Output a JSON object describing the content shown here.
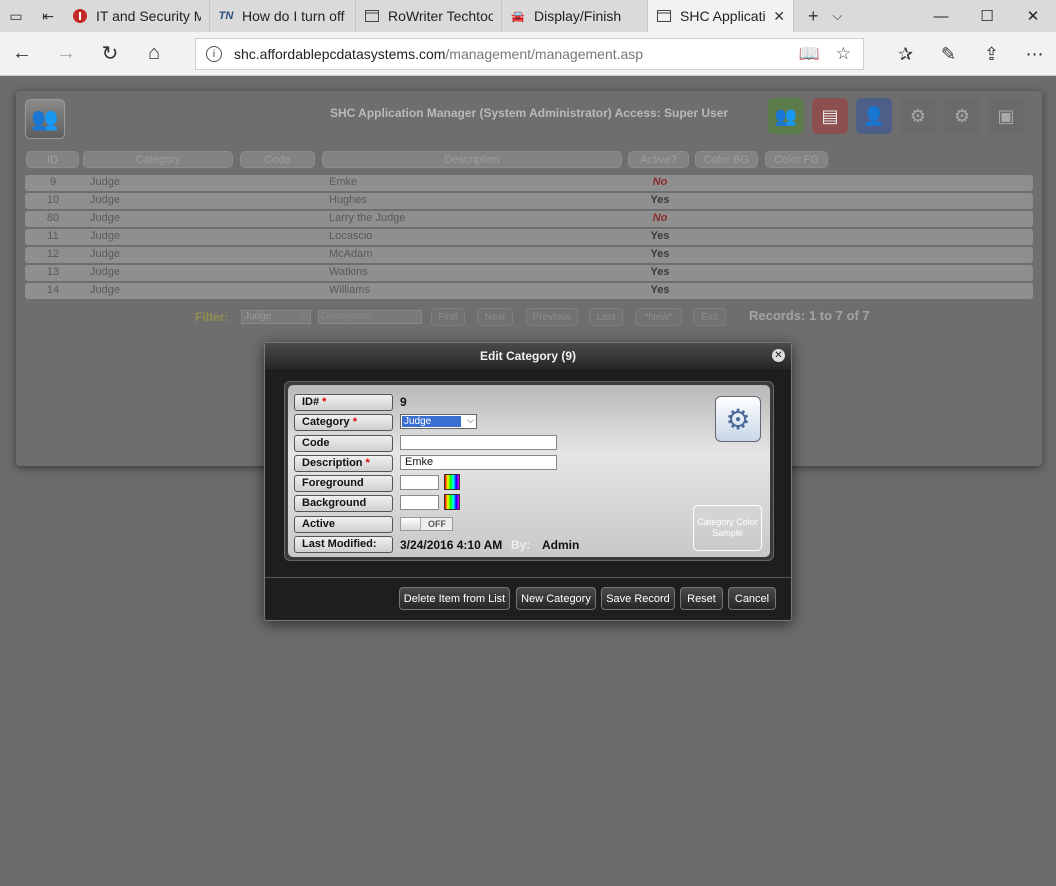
{
  "browser": {
    "tabs": [
      {
        "label": "IT and Security Ma",
        "icon": "red-shield-icon"
      },
      {
        "label": "How do I turn off I",
        "icon": "tn-logo-icon"
      },
      {
        "label": "RoWriter Techtool",
        "icon": "page-icon"
      },
      {
        "label": "Display/Finish",
        "icon": "car-icon"
      },
      {
        "label": "SHC Applicatic",
        "icon": "page-icon",
        "active": true
      }
    ],
    "url_host": "shc.affordablepcdatasystems.com",
    "url_path": "/management/management.asp"
  },
  "app": {
    "title": "SHC Application Manager (System Administrator) Access: Super User",
    "columns": [
      "ID",
      "Category",
      "Code",
      "Description",
      "Active?",
      "Color BG",
      "Color FG"
    ],
    "rows": [
      {
        "id": "9",
        "category": "Judge",
        "description": "Emke",
        "active": "No"
      },
      {
        "id": "10",
        "category": "Judge",
        "description": "Hughes",
        "active": "Yes"
      },
      {
        "id": "80",
        "category": "Judge",
        "description": "Larry the Judge",
        "active": "No"
      },
      {
        "id": "11",
        "category": "Judge",
        "description": "Locascio",
        "active": "Yes"
      },
      {
        "id": "12",
        "category": "Judge",
        "description": "McAdam",
        "active": "Yes"
      },
      {
        "id": "13",
        "category": "Judge",
        "description": "Watkins",
        "active": "Yes"
      },
      {
        "id": "14",
        "category": "Judge",
        "description": "Williams",
        "active": "Yes"
      }
    ],
    "filter": {
      "label": "Filter:",
      "category_value": "Judge",
      "description_placeholder": "Description",
      "buttons": [
        "First",
        "Next",
        "Previous",
        "Last",
        "*New*",
        "Exit"
      ],
      "records": "Records: 1 to 7 of 7"
    }
  },
  "modal": {
    "title": "Edit Category (9)",
    "labels": {
      "id": "ID#",
      "category": "Category",
      "code": "Code",
      "description": "Description",
      "foreground": "Foreground",
      "background": "Background",
      "active": "Active",
      "last_modified": "Last Modified:"
    },
    "required_mark": "*",
    "id_value": "9",
    "category_value": "Judge",
    "code_value": "",
    "description_value": "Emke",
    "active_state": "OFF",
    "last_modified_value": "3/24/2016 4:10 AM",
    "by_label": "By:",
    "by_value": "Admin",
    "color_sample": "Category Color Sample",
    "buttons": {
      "delete": "Delete Item from List",
      "new": "New Category",
      "save": "Save Record",
      "reset": "Reset",
      "cancel": "Cancel"
    }
  },
  "colors": {
    "no_status": "#8b2d2d",
    "modal_bg": "#1e1e1e",
    "selection": "#3a6fd0"
  }
}
